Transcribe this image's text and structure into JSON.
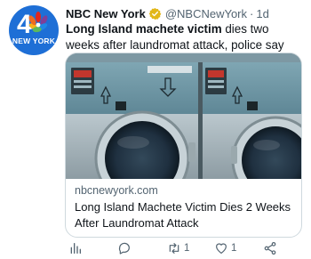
{
  "account": {
    "logo_text": "NEW YORK",
    "display_name": "NBC New York",
    "handle": "@NBCNewYork",
    "separator": "·",
    "time": "1d"
  },
  "tweet": {
    "text_bold": "Long Island machete victim",
    "text_rest": " dies two weeks after laundromat attack, police say"
  },
  "card": {
    "domain": "nbcnewyork.com",
    "title": "Long Island Machete Victim Dies 2 Weeks After Laundromat Attack"
  },
  "actions": {
    "retweets": "1",
    "likes": "1"
  },
  "colors": {
    "avatar_bg": "#1e6fd6",
    "verified_badge": "#e2b719",
    "text_secondary": "#536471",
    "border": "#cfd9de"
  },
  "icons": [
    "nbc-peacock-icon",
    "verified-badge-icon",
    "analytics-icon",
    "reply-icon",
    "retweet-icon",
    "like-icon",
    "share-icon"
  ]
}
